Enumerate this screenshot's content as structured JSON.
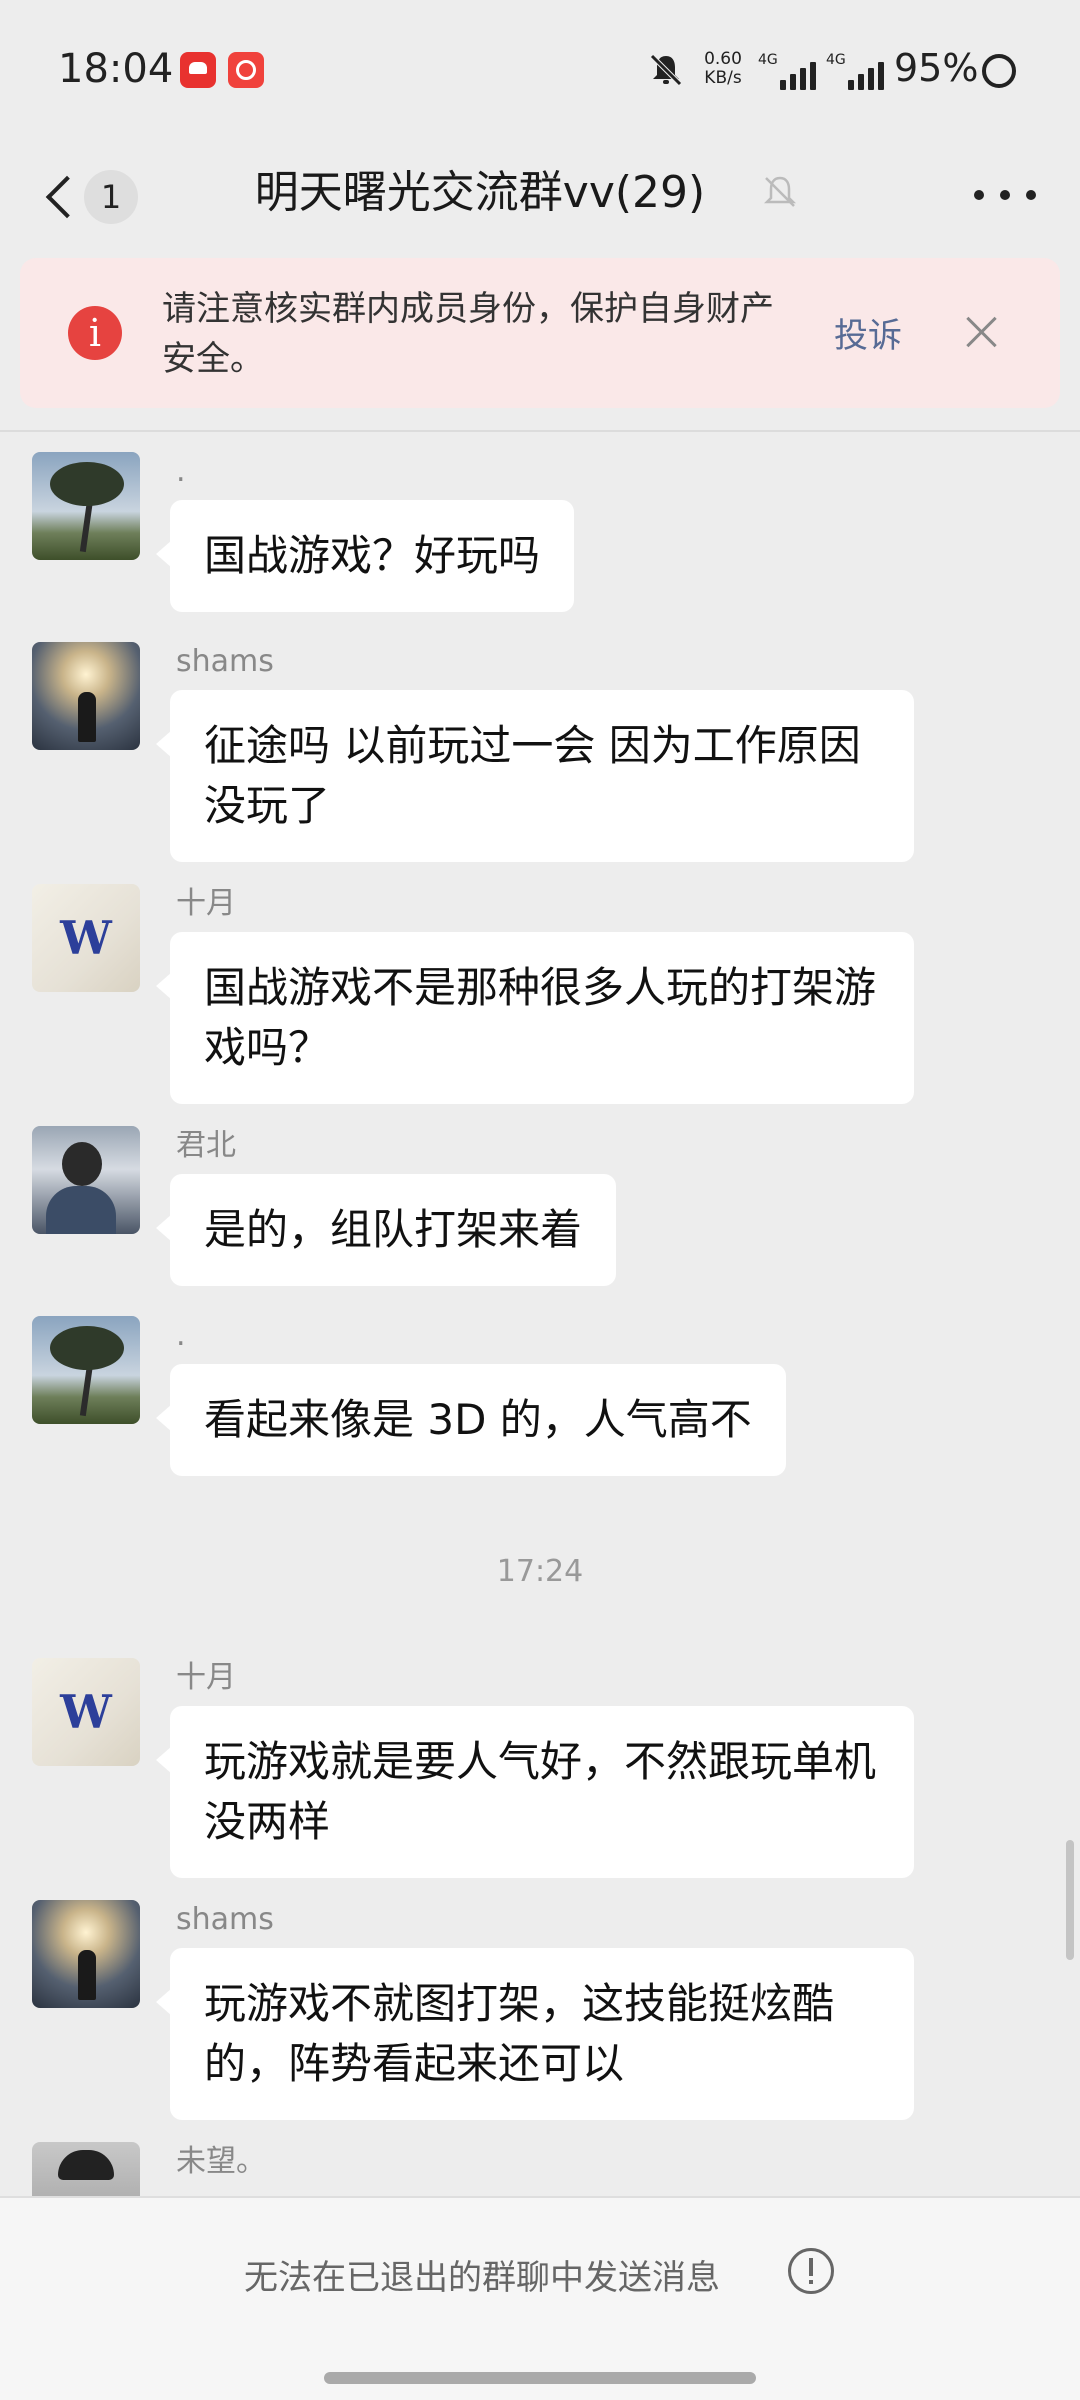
{
  "status_bar": {
    "time": "18:04",
    "speed_value": "0.60",
    "speed_unit": "KB/s",
    "net1": "4G",
    "net2": "4G",
    "battery": "95%"
  },
  "header": {
    "back_icon": "chevron-left-icon",
    "unread_count": "1",
    "title": "明天曙光交流群vv(29)",
    "mute_icon": "bell-off-icon",
    "more_icon": "more-icon"
  },
  "notice": {
    "text": "请注意核实群内成员身份，保护自身财产安全。",
    "report_label": "投诉",
    "icon": "alert-icon",
    "close_icon": "close-icon",
    "color": "#e64340"
  },
  "messages": [
    {
      "sender": ".",
      "text": "国战游戏？好玩吗"
    },
    {
      "sender": "shams",
      "text": "征途吗  以前玩过一会 因为工作原因没玩了"
    },
    {
      "sender": "十月",
      "text": "国战游戏不是那种很多人玩的打架游戏吗？"
    },
    {
      "sender": "君北",
      "text": "是的，组队打架来着"
    },
    {
      "sender": ".",
      "text": "看起来像是 3D 的，人气高不"
    },
    {
      "sender": "十月",
      "text": "玩游戏就是要人气好，不然跟玩单机没两样"
    },
    {
      "sender": "shams",
      "text": "玩游戏不就图打架，这技能挺炫酷的，阵势看起来还可以"
    },
    {
      "sender": "未望。",
      "text": ""
    }
  ],
  "timestamp": "17:24",
  "footer": {
    "notice": "无法在已退出的群聊中发送消息",
    "icon": "info-icon"
  }
}
